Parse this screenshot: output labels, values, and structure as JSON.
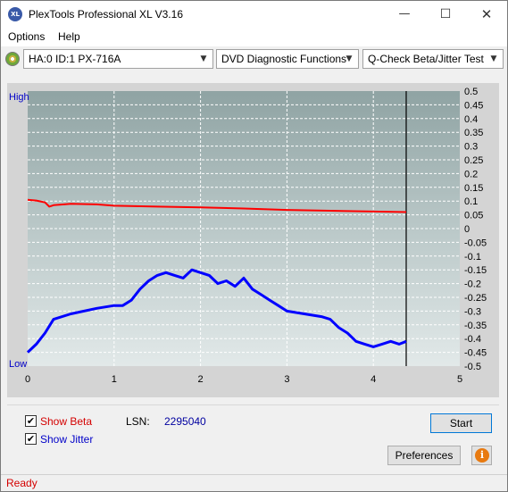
{
  "window": {
    "title": "PlexTools Professional XL V3.16",
    "icon_text": "XL",
    "minimize_icon": "minimize-icon",
    "maximize_icon": "maximize-icon",
    "close_icon": "close-icon"
  },
  "menu": {
    "items": [
      "Options",
      "Help"
    ]
  },
  "toolbar": {
    "drive": "HA:0 ID:1  PX-716A",
    "function": "DVD Diagnostic Functions",
    "test": "Q-Check Beta/Jitter Test"
  },
  "chart": {
    "high_label": "High",
    "low_label": "Low"
  },
  "chart_data": {
    "type": "line",
    "title": "",
    "xlabel": "",
    "ylabel": "",
    "x_ticks": [
      "0",
      "1",
      "2",
      "3",
      "4",
      "5"
    ],
    "y_right_ticks": [
      "0.5",
      "0.45",
      "0.4",
      "0.35",
      "0.3",
      "0.25",
      "0.2",
      "0.15",
      "0.1",
      "0.05",
      "0",
      "-0.05",
      "-0.1",
      "-0.15",
      "-0.2",
      "-0.25",
      "-0.3",
      "-0.35",
      "-0.4",
      "-0.45",
      "-0.5"
    ],
    "xlim": [
      0,
      5
    ],
    "ylim": [
      -0.5,
      0.5
    ],
    "grid": true,
    "end_marker_x": 4.38,
    "series": [
      {
        "color": "#ff0000",
        "x": [
          0,
          0.1,
          0.2,
          0.25,
          0.3,
          0.5,
          0.8,
          1.0,
          1.5,
          2.0,
          2.5,
          3.0,
          3.5,
          4.0,
          4.38
        ],
        "values": [
          0.105,
          0.102,
          0.095,
          0.08,
          0.085,
          0.09,
          0.088,
          0.083,
          0.08,
          0.077,
          0.073,
          0.068,
          0.065,
          0.062,
          0.06
        ]
      },
      {
        "color": "#0000ff",
        "x": [
          0,
          0.1,
          0.2,
          0.3,
          0.5,
          0.8,
          1.0,
          1.1,
          1.2,
          1.3,
          1.4,
          1.5,
          1.6,
          1.7,
          1.8,
          1.9,
          2.0,
          2.1,
          2.2,
          2.3,
          2.4,
          2.5,
          2.6,
          2.7,
          2.8,
          2.9,
          3.0,
          3.2,
          3.4,
          3.5,
          3.6,
          3.7,
          3.8,
          3.9,
          4.0,
          4.1,
          4.2,
          4.3,
          4.38
        ],
        "values": [
          -0.45,
          -0.42,
          -0.38,
          -0.33,
          -0.31,
          -0.29,
          -0.28,
          -0.28,
          -0.26,
          -0.22,
          -0.19,
          -0.17,
          -0.16,
          -0.17,
          -0.18,
          -0.15,
          -0.16,
          -0.17,
          -0.2,
          -0.19,
          -0.21,
          -0.18,
          -0.22,
          -0.24,
          -0.26,
          -0.28,
          -0.3,
          -0.31,
          -0.32,
          -0.33,
          -0.36,
          -0.38,
          -0.41,
          -0.42,
          -0.43,
          -0.42,
          -0.41,
          -0.42,
          -0.41
        ]
      }
    ]
  },
  "options": {
    "show_beta": "Show Beta",
    "show_beta_checked": true,
    "show_jitter": "Show Jitter",
    "show_jitter_checked": true,
    "lsn_label": "LSN:",
    "lsn_value": "2295040",
    "beta_color": "#d40000",
    "jitter_color": "#0000c8"
  },
  "buttons": {
    "start": "Start",
    "preferences": "Preferences",
    "info_icon": "info-icon"
  },
  "status": {
    "text": "Ready",
    "color": "#d40000"
  }
}
